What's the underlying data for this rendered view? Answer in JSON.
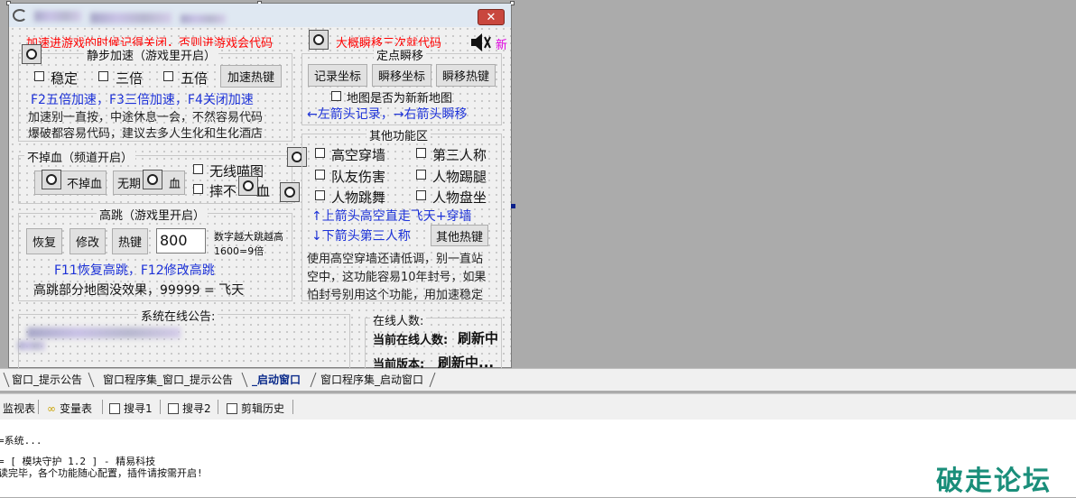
{
  "form": {
    "close_label": "✕",
    "warning": "加速进游戏的时候记得关闭，否则进游戏会代码",
    "teleport_note": "大概瞬移三次就代码",
    "new_label": "新"
  },
  "speed": {
    "title": "静步加速（游戏里开启）",
    "opt_stable": "稳定",
    "opt_3x": "三倍",
    "opt_5x": "五倍",
    "hotkey_btn": "加速热键",
    "keys_line": "F2五倍加速，F3三倍加速，F4关闭加速",
    "note1": "加速别一直按，中途休息一会，不然容易代码",
    "note2": "爆破都容易代码，建议去多人生化和生化酒店"
  },
  "blood": {
    "title": "不掉血（频道开启）",
    "btn1": "不掉血",
    "btn2": "无期",
    "btn2_tail": "血",
    "opt_ghost": "无线喵图",
    "opt_fall": "摔不",
    "opt_fall_tail": "血"
  },
  "jump": {
    "title": "高跳（游戏里开启）",
    "restore_btn": "恢复",
    "modify_btn": "修改",
    "hotkey_btn": "热键",
    "value": "800",
    "hint1": "数字越大跳越高",
    "hint2": "1600=9倍",
    "keys_line": "F11恢复高跳，F12修改高跳",
    "note": "高跳部分地图没效果，99999 = 飞天"
  },
  "teleport": {
    "title": "定点瞬移",
    "record_btn": "记录坐标",
    "teleport_btn": "瞬移坐标",
    "hotkey_btn": "瞬移热键",
    "new_map_cb": "地图是否为新新地图",
    "keys_line": "←左箭头记录，→右箭头瞬移"
  },
  "other": {
    "title": "其他功能区",
    "opt1": "高空穿墙",
    "opt2": "第三人称",
    "opt3": "队友伤害",
    "opt4": "人物踢腿",
    "opt5": "人物跳舞",
    "opt6": "人物盘坐",
    "line1": "↑上箭头高空直走飞天+穿墙",
    "line2": "↓下箭头第三人称",
    "hotkey_btn": "其他热键",
    "note1": "使用高空穿墙还请低调，别一直站",
    "note2": "空中，这功能容易10年封号，如果",
    "note3": "怕封号别用这个功能，用加速稳定"
  },
  "notice": {
    "title": "系统在线公告:"
  },
  "online": {
    "label": "在线人数:",
    "current_online_label": "当前在线人数:",
    "current_online_value": "刷新中",
    "version_label": "当前版本:",
    "version_value": "刷新中..."
  },
  "tabs": [
    "窗口_提示公告",
    "窗口程序集_窗口_提示公告",
    "_启动窗口",
    "窗口程序集_启动窗口"
  ],
  "tools": {
    "watch": "监视表",
    "vars": "变量表",
    "find1": "搜寻1",
    "find2": "搜寻2",
    "clip": "剪辑历史"
  },
  "output": {
    "line1": "=系统...",
    "line2": "= [ 模块守护 1.2 ] - 精易科技",
    "line3": "读完毕，各个功能随心配置，插件请按需开启!"
  },
  "watermark": "破走论坛",
  "colors": {
    "warning_red": "#ff0000",
    "hint_blue": "#1d32d8",
    "new_magenta": "#e000e0",
    "watermark_green": "#1a8e7a"
  }
}
